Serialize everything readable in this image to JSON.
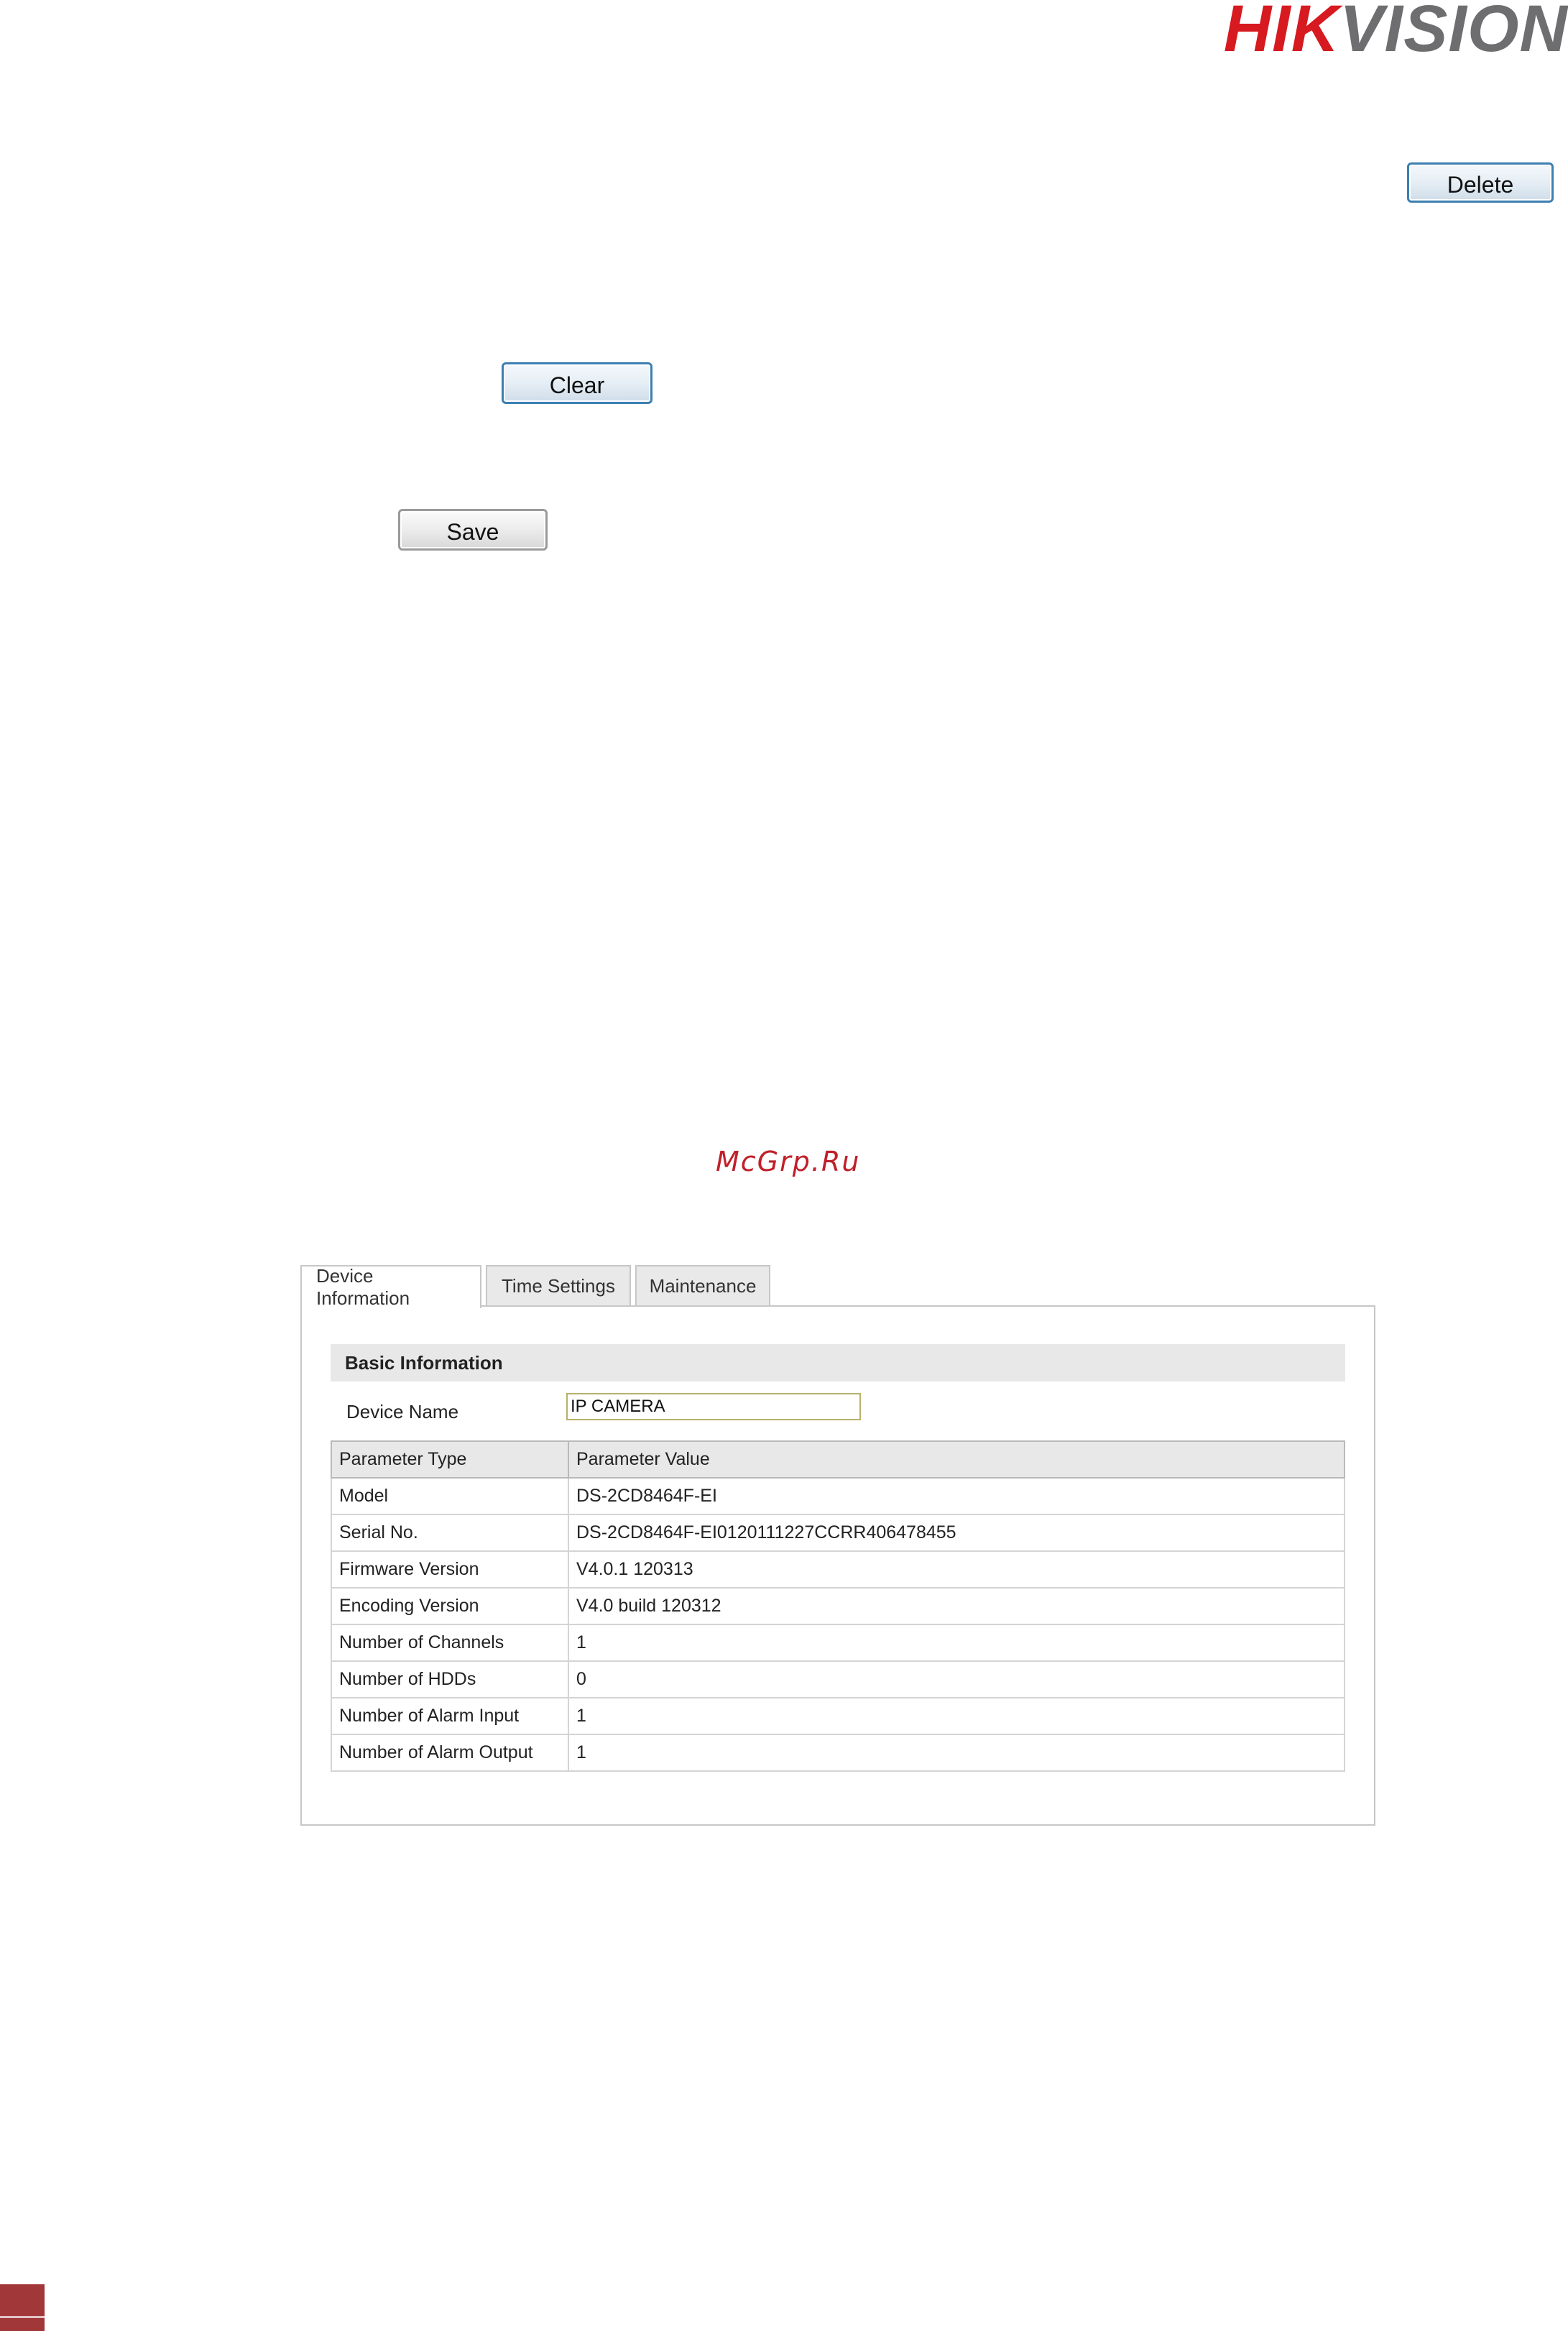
{
  "brand": {
    "logo_part_a": "HIK",
    "logo_part_b": "VISION",
    "color_primary": "#d71920",
    "color_secondary": "#6e6e70"
  },
  "buttons": {
    "delete_label": "Delete",
    "clear_label": "Clear",
    "save_label": "Save"
  },
  "watermark": "McGrp.Ru",
  "device_panel": {
    "tabs": [
      {
        "label": "Device Information",
        "active": true
      },
      {
        "label": "Time Settings",
        "active": false
      },
      {
        "label": "Maintenance",
        "active": false
      }
    ],
    "section_title": "Basic Information",
    "device_name_label": "Device Name",
    "device_name_value": "IP CAMERA",
    "table": {
      "headers": [
        "Parameter Type",
        "Parameter Value"
      ],
      "rows": [
        [
          "Model",
          "DS-2CD8464F-EI"
        ],
        [
          "Serial No.",
          "DS-2CD8464F-EI0120111227CCRR406478455"
        ],
        [
          "Firmware Version",
          "V4.0.1 120313"
        ],
        [
          "Encoding Version",
          "V4.0 build 120312"
        ],
        [
          "Number of Channels",
          "1"
        ],
        [
          "Number of HDDs",
          "0"
        ],
        [
          "Number of Alarm Input",
          "1"
        ],
        [
          "Number of Alarm Output",
          "1"
        ]
      ]
    }
  },
  "page_marker_color": "#a2373a"
}
